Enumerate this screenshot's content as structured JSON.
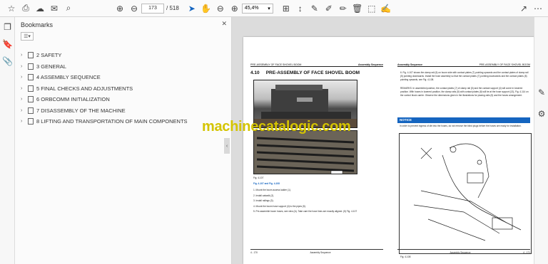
{
  "toolbar": {
    "page_current": "173",
    "page_total": "/ 518",
    "zoom": "45,4%",
    "icons": [
      "star-icon",
      "print-icon",
      "upload-icon",
      "mail-icon",
      "search-icon",
      "up-icon",
      "down-icon",
      "cursor-icon",
      "hand-icon",
      "zoom-out-icon",
      "zoom-in-icon",
      "fit-icon",
      "comment-icon",
      "pen-icon",
      "highlight-icon",
      "delete-icon",
      "stamp-icon",
      "sign-icon",
      "share-icon",
      "more-icon"
    ]
  },
  "panel": {
    "title": "Bookmarks",
    "bookmarks": [
      "2 SAFETY",
      "3 GENERAL",
      "4 ASSEMBLY SEQUENCE",
      "5 FINAL CHECKS AND ADJUSTMENTS",
      "6 ORBCOMM INITIALIZATION",
      "7 DISASSEMBLY OF THE MACHINE",
      "8 LIFTING AND TRANSPORTATION OF MAIN COMPONENTS"
    ]
  },
  "doc": {
    "left": {
      "header_left": "PRE-ASSEMBLY OF FACE SHOVEL BOOM",
      "header_right": "Assembly Sequence",
      "section_num": "4.10",
      "section_title": "PRE-ASSEMBLY OF FACE SHOVEL BOOM",
      "fig_label": "Fig. 4-107",
      "ref": "Fig. 4-107 and Fig. 4-108",
      "steps": [
        "1.   Mount the boom access ladder (1).",
        "2.   Install catwalk (2).",
        "3.   Install railings (3).",
        "4.   Mount the boom hose support (4) to the pipes (5).",
        "5.   Pre-assemble boom hoses, see view (A). Take care the hose lines are exactly aligned. (5) Fig. 4-107"
      ],
      "footer_left": "4 - 170",
      "footer_center": "Assembly Sequence"
    },
    "right": {
      "header_left": "Assembly Sequence",
      "header_right": "PRE-ASSEMBLY OF FACE SHOVEL BOOM",
      "para1": "6.  Fig. 4-107 shows the clamp rail (6) on boom side with contact plates (7) pointing upwards and the contact plates of clamp rail (5) pointing downwards. Install the hose assembly so that the contact plates (7) pointing downwards and the contact plates (8) pointing upwards, see Fig. 4-108.",
      "remark": "REMARKS:  In assembled position, the contact plates (7) of clamp rail (5) and the contact support (4) will come in lowered position. With hoses in lowered position, the clamp rails (5) with contact plates (8) will be at the hose support (13), Fig. 4-114 on the control block carrier. Observe the dimensions given in the illustrations for placing rails (5) and the hoses arrangement.",
      "notice_title": "NOTICE",
      "notice_text": "In order to prevent ingress of dirt into the hoses, do not remove the blind plugs before the hoses are ready for installation.",
      "fig_label": "Fig. 4-108",
      "footer_center": "Assembly Sequence",
      "footer_right": "4 - 171"
    }
  },
  "watermark": "machinecatalogic.com"
}
